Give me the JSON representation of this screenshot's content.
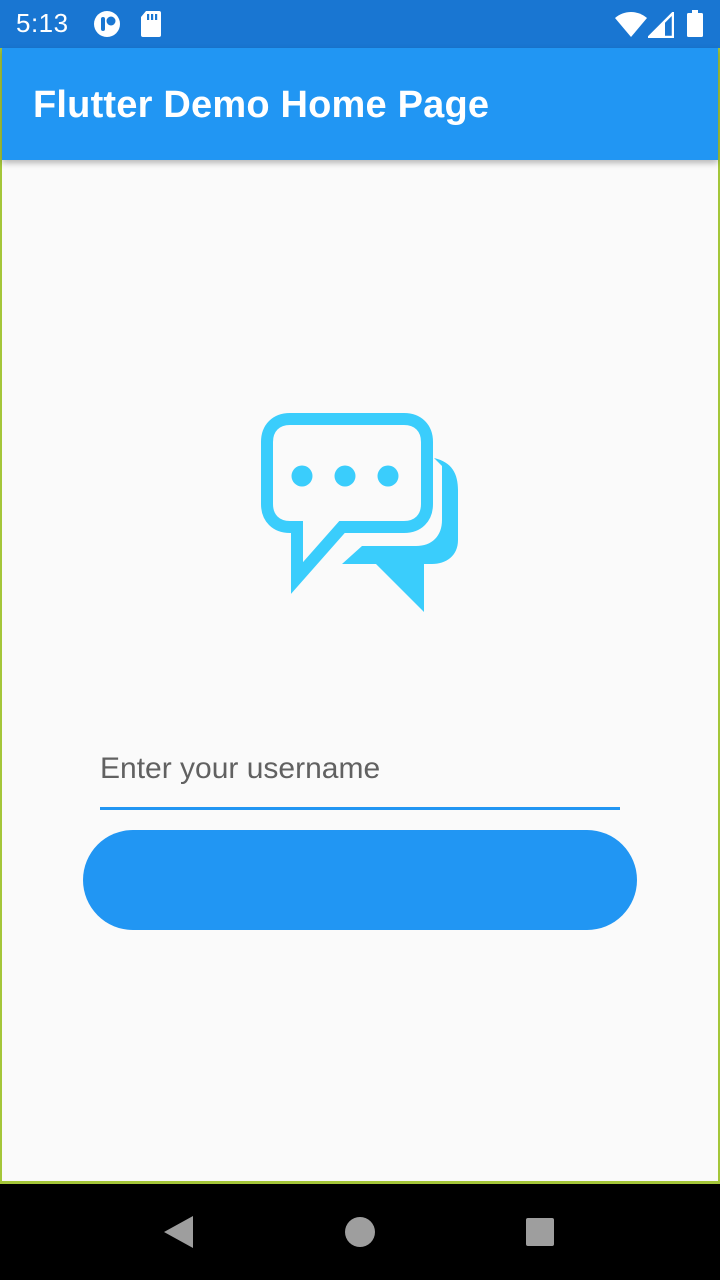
{
  "status_bar": {
    "time": "5:13",
    "icons": {
      "left": [
        "notification-icon",
        "sd-card-icon"
      ],
      "right": [
        "wifi-icon",
        "cell-signal-icon",
        "battery-icon"
      ]
    }
  },
  "app_bar": {
    "title": "Flutter Demo Home Page"
  },
  "logo": {
    "icon": "chat-bubbles-icon",
    "color": "#3acdfc"
  },
  "form": {
    "username_placeholder": "Enter your username",
    "username_value": "",
    "button_label": ""
  },
  "nav_bar": {
    "buttons": [
      "back-icon",
      "home-icon",
      "recents-icon"
    ]
  },
  "colors": {
    "status_bar": "#1976d2",
    "app_bar": "#2196f3",
    "accent": "#2196f3",
    "background": "#fafafa",
    "frame_border": "#a4c639"
  }
}
